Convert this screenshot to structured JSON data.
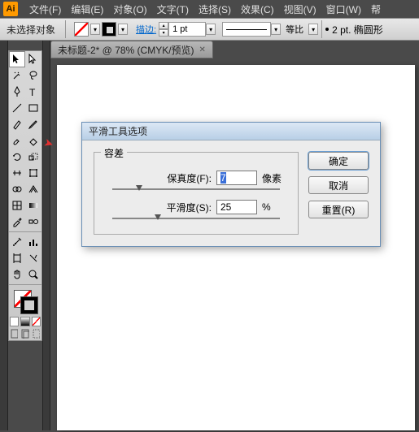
{
  "app": {
    "icon": "Ai"
  },
  "menu": {
    "items": [
      "文件(F)",
      "编辑(E)",
      "对象(O)",
      "文字(T)",
      "选择(S)",
      "效果(C)",
      "视图(V)",
      "窗口(W)",
      "帮"
    ]
  },
  "options": {
    "no_selection": "未选择对象",
    "stroke_label": "描边:",
    "pt_value": "1 pt",
    "ratio_label": "等比",
    "shape_label": "2 pt. 椭圆形"
  },
  "doc": {
    "tab": "未标题-2* @ 78% (CMYK/预览)"
  },
  "dialog": {
    "title": "平滑工具选项",
    "legend": "容差",
    "fidelity_label": "保真度(F):",
    "fidelity_value": "7",
    "fidelity_unit": "像素",
    "smooth_label": "平滑度(S):",
    "smooth_value": "25",
    "smooth_unit": "%",
    "ok": "确定",
    "cancel": "取消",
    "reset": "重置(R)"
  }
}
